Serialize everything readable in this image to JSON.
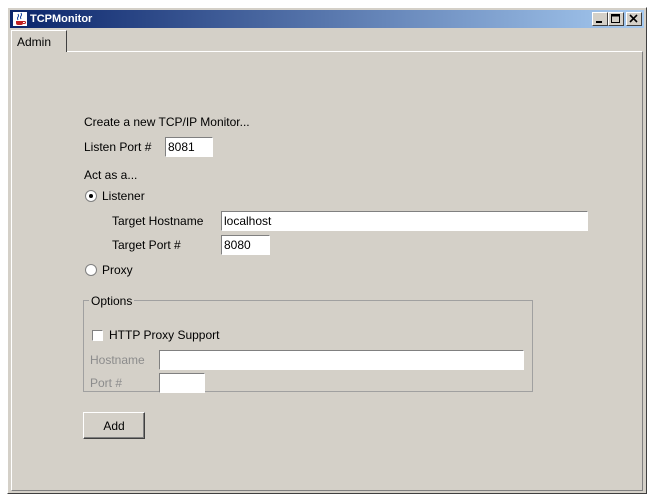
{
  "window": {
    "title": "TCPMonitor"
  },
  "tabs": [
    {
      "label": "Admin"
    }
  ],
  "admin": {
    "heading": "Create a new TCP/IP Monitor...",
    "listen_port_label": "Listen Port #",
    "listen_port_value": "8081",
    "act_as_label": "Act as a...",
    "listener": {
      "label": "Listener",
      "selected": true,
      "target_hostname_label": "Target Hostname",
      "target_hostname_value": "localhost",
      "target_port_label": "Target Port #",
      "target_port_value": "8080"
    },
    "proxy": {
      "label": "Proxy",
      "selected": false
    },
    "options": {
      "legend": "Options",
      "http_proxy_support_label": "HTTP Proxy Support",
      "http_proxy_support_checked": false,
      "hostname_label": "Hostname",
      "hostname_value": "",
      "port_label": "Port #",
      "port_value": ""
    },
    "add_button_label": "Add"
  },
  "colors": {
    "window_bg": "#d4d0c8",
    "titlebar_start": "#0a246a",
    "titlebar_end": "#a6caf0",
    "disabled_text": "#8c8c8c"
  }
}
